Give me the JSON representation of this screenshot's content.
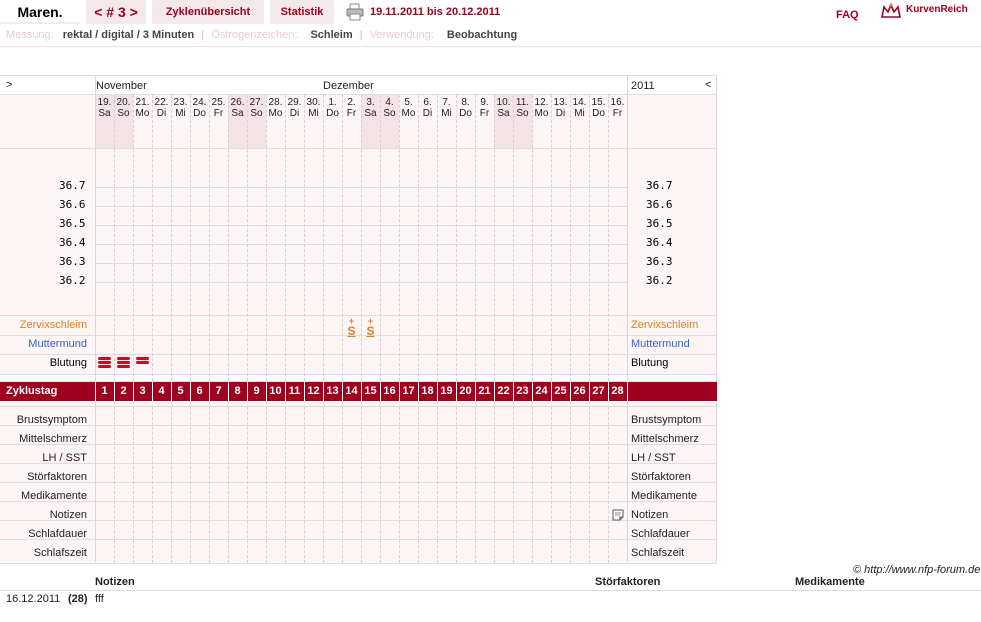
{
  "header": {
    "logo": "Maren.",
    "cycle_nav": "< # 3 >",
    "cycle_prev": "<",
    "cycle_label": "# 3",
    "cycle_next": ">",
    "tab_overview": "Zyklenübersicht",
    "tab_stats": "Statistik",
    "date_range": "19.11.2011 bis 20.12.2011",
    "faq": "FAQ",
    "brand": "KurvenReich"
  },
  "info": {
    "measure_label": "Messung:",
    "measure_value": "rektal / digital / 3 Minuten",
    "estrogen_label": "Östrogenzeichen:",
    "estrogen_value": "Schleim",
    "use_label": "Verwendung:",
    "use_value": "Beobachtung"
  },
  "chart": {
    "nav_left": ">",
    "nav_right": "<",
    "month1": "November",
    "month2": "Dezember",
    "year": "2011",
    "days": [
      {
        "d": "19.",
        "w": "Sa",
        "we": true
      },
      {
        "d": "20.",
        "w": "So",
        "we": true
      },
      {
        "d": "21.",
        "w": "Mo"
      },
      {
        "d": "22.",
        "w": "Di"
      },
      {
        "d": "23.",
        "w": "Mi"
      },
      {
        "d": "24.",
        "w": "Do"
      },
      {
        "d": "25.",
        "w": "Fr"
      },
      {
        "d": "26.",
        "w": "Sa",
        "we": true
      },
      {
        "d": "27.",
        "w": "So",
        "we": true
      },
      {
        "d": "28.",
        "w": "Mo"
      },
      {
        "d": "29.",
        "w": "Di"
      },
      {
        "d": "30.",
        "w": "Mi"
      },
      {
        "d": "1.",
        "w": "Do"
      },
      {
        "d": "2.",
        "w": "Fr"
      },
      {
        "d": "3.",
        "w": "Sa",
        "we": true
      },
      {
        "d": "4.",
        "w": "So",
        "we": true
      },
      {
        "d": "5.",
        "w": "Mo"
      },
      {
        "d": "6.",
        "w": "Di"
      },
      {
        "d": "7.",
        "w": "Mi"
      },
      {
        "d": "8.",
        "w": "Do"
      },
      {
        "d": "9.",
        "w": "Fr"
      },
      {
        "d": "10.",
        "w": "Sa",
        "we": true
      },
      {
        "d": "11.",
        "w": "So",
        "we": true
      },
      {
        "d": "12.",
        "w": "Mo"
      },
      {
        "d": "13.",
        "w": "Di"
      },
      {
        "d": "14.",
        "w": "Mi"
      },
      {
        "d": "15.",
        "w": "Do"
      },
      {
        "d": "16.",
        "w": "Fr"
      }
    ],
    "temps": [
      "36.7",
      "36.6",
      "36.5",
      "36.4",
      "36.3",
      "36.2"
    ],
    "row_cervix": "Zervixschleim",
    "row_mm": "Muttermund",
    "row_bleed": "Blutung",
    "row_cycleday": "Zyklustag",
    "cycle_days": [
      "1",
      "2",
      "3",
      "4",
      "5",
      "6",
      "7",
      "8",
      "9",
      "10",
      "11",
      "12",
      "13",
      "14",
      "15",
      "16",
      "17",
      "18",
      "19",
      "20",
      "21",
      "22",
      "23",
      "24",
      "25",
      "26",
      "27",
      "28"
    ],
    "symptom_rows": [
      "Brustsymptom",
      "Mittelschmerz",
      "LH / SST",
      "Störfaktoren",
      "Medikamente",
      "Notizen",
      "Schlafdauer",
      "Schlafszeit"
    ],
    "mucus_symbol": "S",
    "mucus_mark": "+",
    "mucus_days": [
      14,
      15
    ],
    "bleeding": [
      {
        "day": 1,
        "level": 3
      },
      {
        "day": 2,
        "level": 3
      },
      {
        "day": 3,
        "level": 2
      }
    ],
    "note_day": 28,
    "colors": {
      "accent": "#a00020",
      "weekend": "#f3e3e6",
      "bg": "#fbf5f6",
      "mucus": "#e08020",
      "mm": "#4060c0",
      "bleed": "#c01020"
    }
  },
  "footer": {
    "copyright": "© http://www.nfp-forum.de",
    "col_notes": "Notizen",
    "col_disturb": "Störfaktoren",
    "col_meds": "Medikamente",
    "row_date": "16.12.2011",
    "row_day": "(28)",
    "row_note": "fff"
  }
}
